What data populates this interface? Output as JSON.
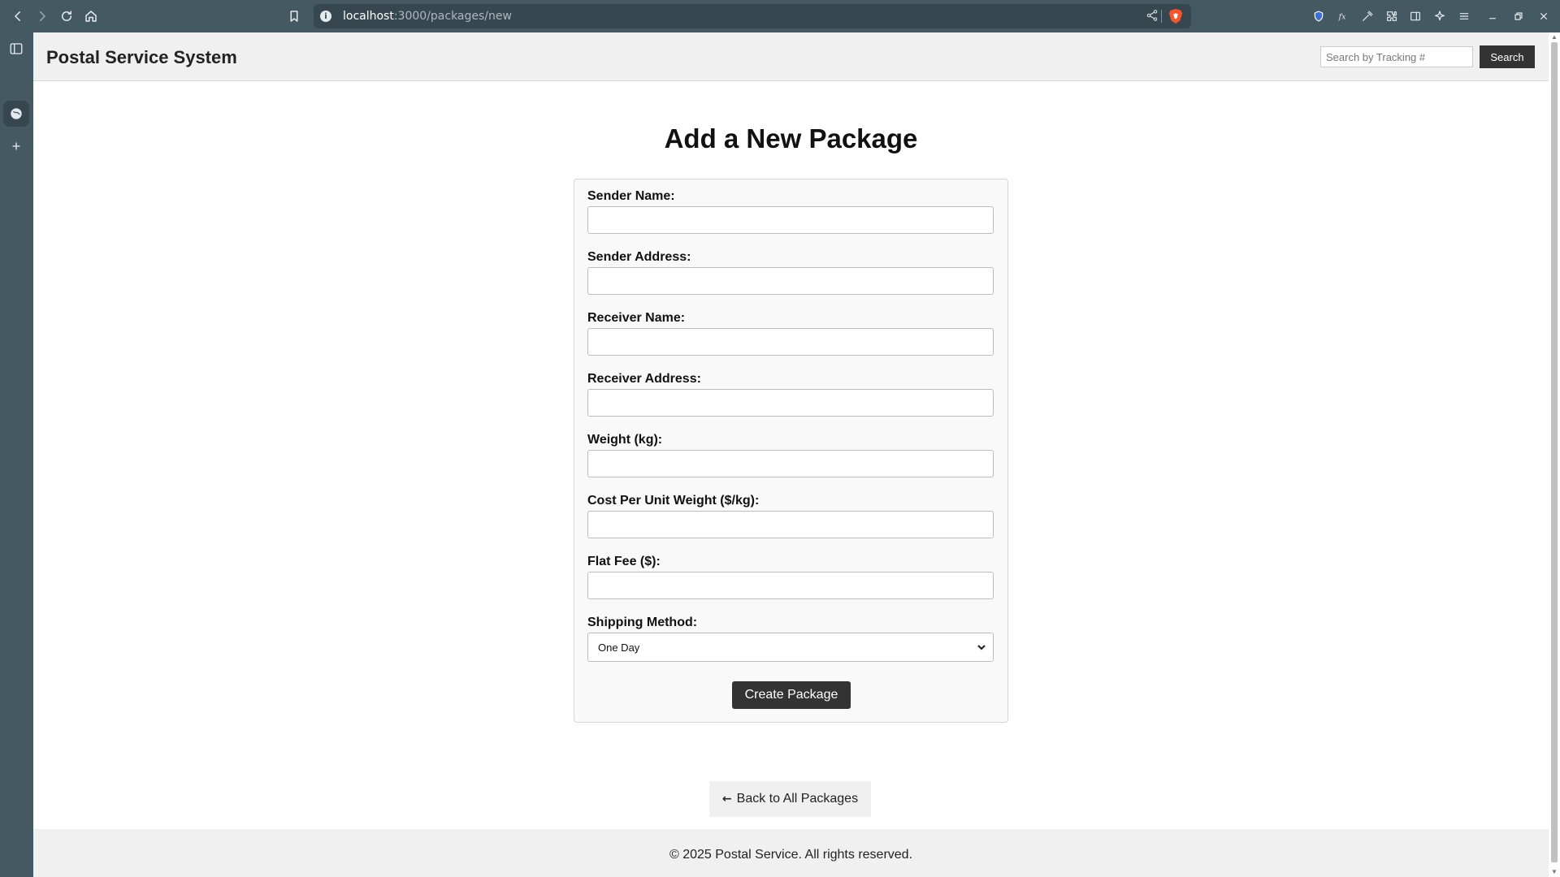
{
  "browser": {
    "url_host": "localhost",
    "url_path": ":3000/packages/new"
  },
  "header": {
    "site_title": "Postal Service System",
    "search_placeholder": "Search by Tracking #",
    "search_button": "Search"
  },
  "main": {
    "heading": "Add a New Package",
    "fields": [
      {
        "label": "Sender Name:",
        "value": ""
      },
      {
        "label": "Sender Address:",
        "value": ""
      },
      {
        "label": "Receiver Name:",
        "value": ""
      },
      {
        "label": "Receiver Address:",
        "value": ""
      },
      {
        "label": "Weight (kg):",
        "value": ""
      },
      {
        "label": "Cost Per Unit Weight ($/kg):",
        "value": ""
      },
      {
        "label": "Flat Fee ($):",
        "value": ""
      }
    ],
    "shipping": {
      "label": "Shipping Method:",
      "selected": "One Day"
    },
    "submit_label": "Create Package",
    "back_label": "Back to All Packages"
  },
  "footer": {
    "text": "© 2025 Postal Service. All rights reserved."
  },
  "icons": {
    "back": "chevron-left-icon",
    "forward": "chevron-right-icon",
    "reload": "reload-icon",
    "home": "home-icon",
    "bookmark": "bookmark-icon",
    "share": "share-icon",
    "brave": "brave-shield-icon",
    "back_arrow": "arrow-left-icon"
  },
  "colors": {
    "chrome": "#455963",
    "header_bg": "#f0f0f0",
    "button_dark": "#333333"
  }
}
